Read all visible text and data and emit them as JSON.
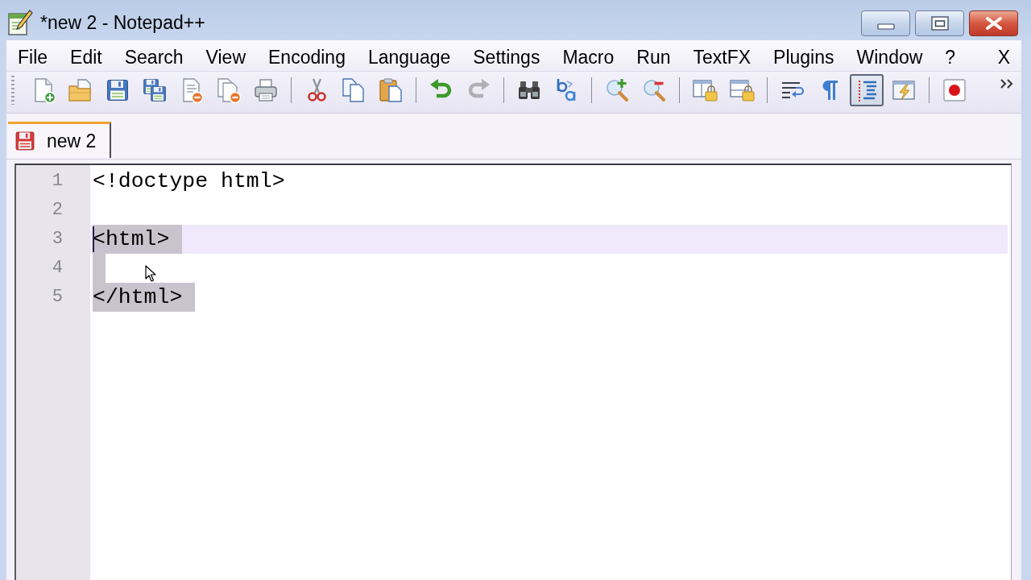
{
  "window": {
    "title": "*new 2 - Notepad++"
  },
  "menu": {
    "items": [
      "File",
      "Edit",
      "Search",
      "View",
      "Encoding",
      "Language",
      "Settings",
      "Macro",
      "Run",
      "TextFX",
      "Plugins",
      "Window",
      "?"
    ],
    "close_document": "X"
  },
  "toolbar": {
    "groups": [
      {
        "buttons": [
          {
            "kind": "new",
            "pressed": false,
            "disabled": false
          },
          {
            "kind": "open",
            "pressed": false,
            "disabled": false
          },
          {
            "kind": "save",
            "pressed": false,
            "disabled": false
          },
          {
            "kind": "save-all",
            "pressed": false,
            "disabled": false
          },
          {
            "kind": "close",
            "pressed": false,
            "disabled": false
          },
          {
            "kind": "close-all",
            "pressed": false,
            "disabled": false
          },
          {
            "kind": "print",
            "pressed": false,
            "disabled": false
          }
        ]
      },
      {
        "buttons": [
          {
            "kind": "cut",
            "pressed": false,
            "disabled": false
          },
          {
            "kind": "copy",
            "pressed": false,
            "disabled": false
          },
          {
            "kind": "paste",
            "pressed": false,
            "disabled": false
          }
        ]
      },
      {
        "buttons": [
          {
            "kind": "undo",
            "pressed": false,
            "disabled": false
          },
          {
            "kind": "redo",
            "pressed": false,
            "disabled": true
          }
        ]
      },
      {
        "buttons": [
          {
            "kind": "find",
            "pressed": false,
            "disabled": false
          },
          {
            "kind": "replace",
            "pressed": false,
            "disabled": false
          }
        ]
      },
      {
        "buttons": [
          {
            "kind": "zoom-in",
            "pressed": false,
            "disabled": false
          },
          {
            "kind": "zoom-out",
            "pressed": false,
            "disabled": false
          }
        ]
      },
      {
        "buttons": [
          {
            "kind": "sync-vertical",
            "pressed": false,
            "disabled": false
          },
          {
            "kind": "sync-horizontal",
            "pressed": false,
            "disabled": false
          }
        ]
      },
      {
        "buttons": [
          {
            "kind": "word-wrap",
            "pressed": false,
            "disabled": false
          },
          {
            "kind": "all-chars",
            "pressed": false,
            "disabled": false
          },
          {
            "kind": "indent-guide",
            "pressed": true,
            "disabled": false
          },
          {
            "kind": "user-language",
            "pressed": false,
            "disabled": false
          }
        ]
      },
      {
        "buttons": [
          {
            "kind": "record",
            "pressed": false,
            "disabled": false
          }
        ]
      }
    ]
  },
  "tabs": [
    {
      "label": "new 2",
      "selected": true,
      "modified": true
    }
  ],
  "editor": {
    "lines": [
      {
        "number": "1",
        "text": "<!doctype html>",
        "current": false,
        "selected": false
      },
      {
        "number": "2",
        "current": false,
        "selected": false
      },
      {
        "number": "3",
        "text": "<html>",
        "current": true,
        "selected": true
      },
      {
        "number": "4",
        "current": false,
        "selected": true
      },
      {
        "number": "5",
        "text": "</html>",
        "current": false,
        "selected": true
      }
    ]
  }
}
